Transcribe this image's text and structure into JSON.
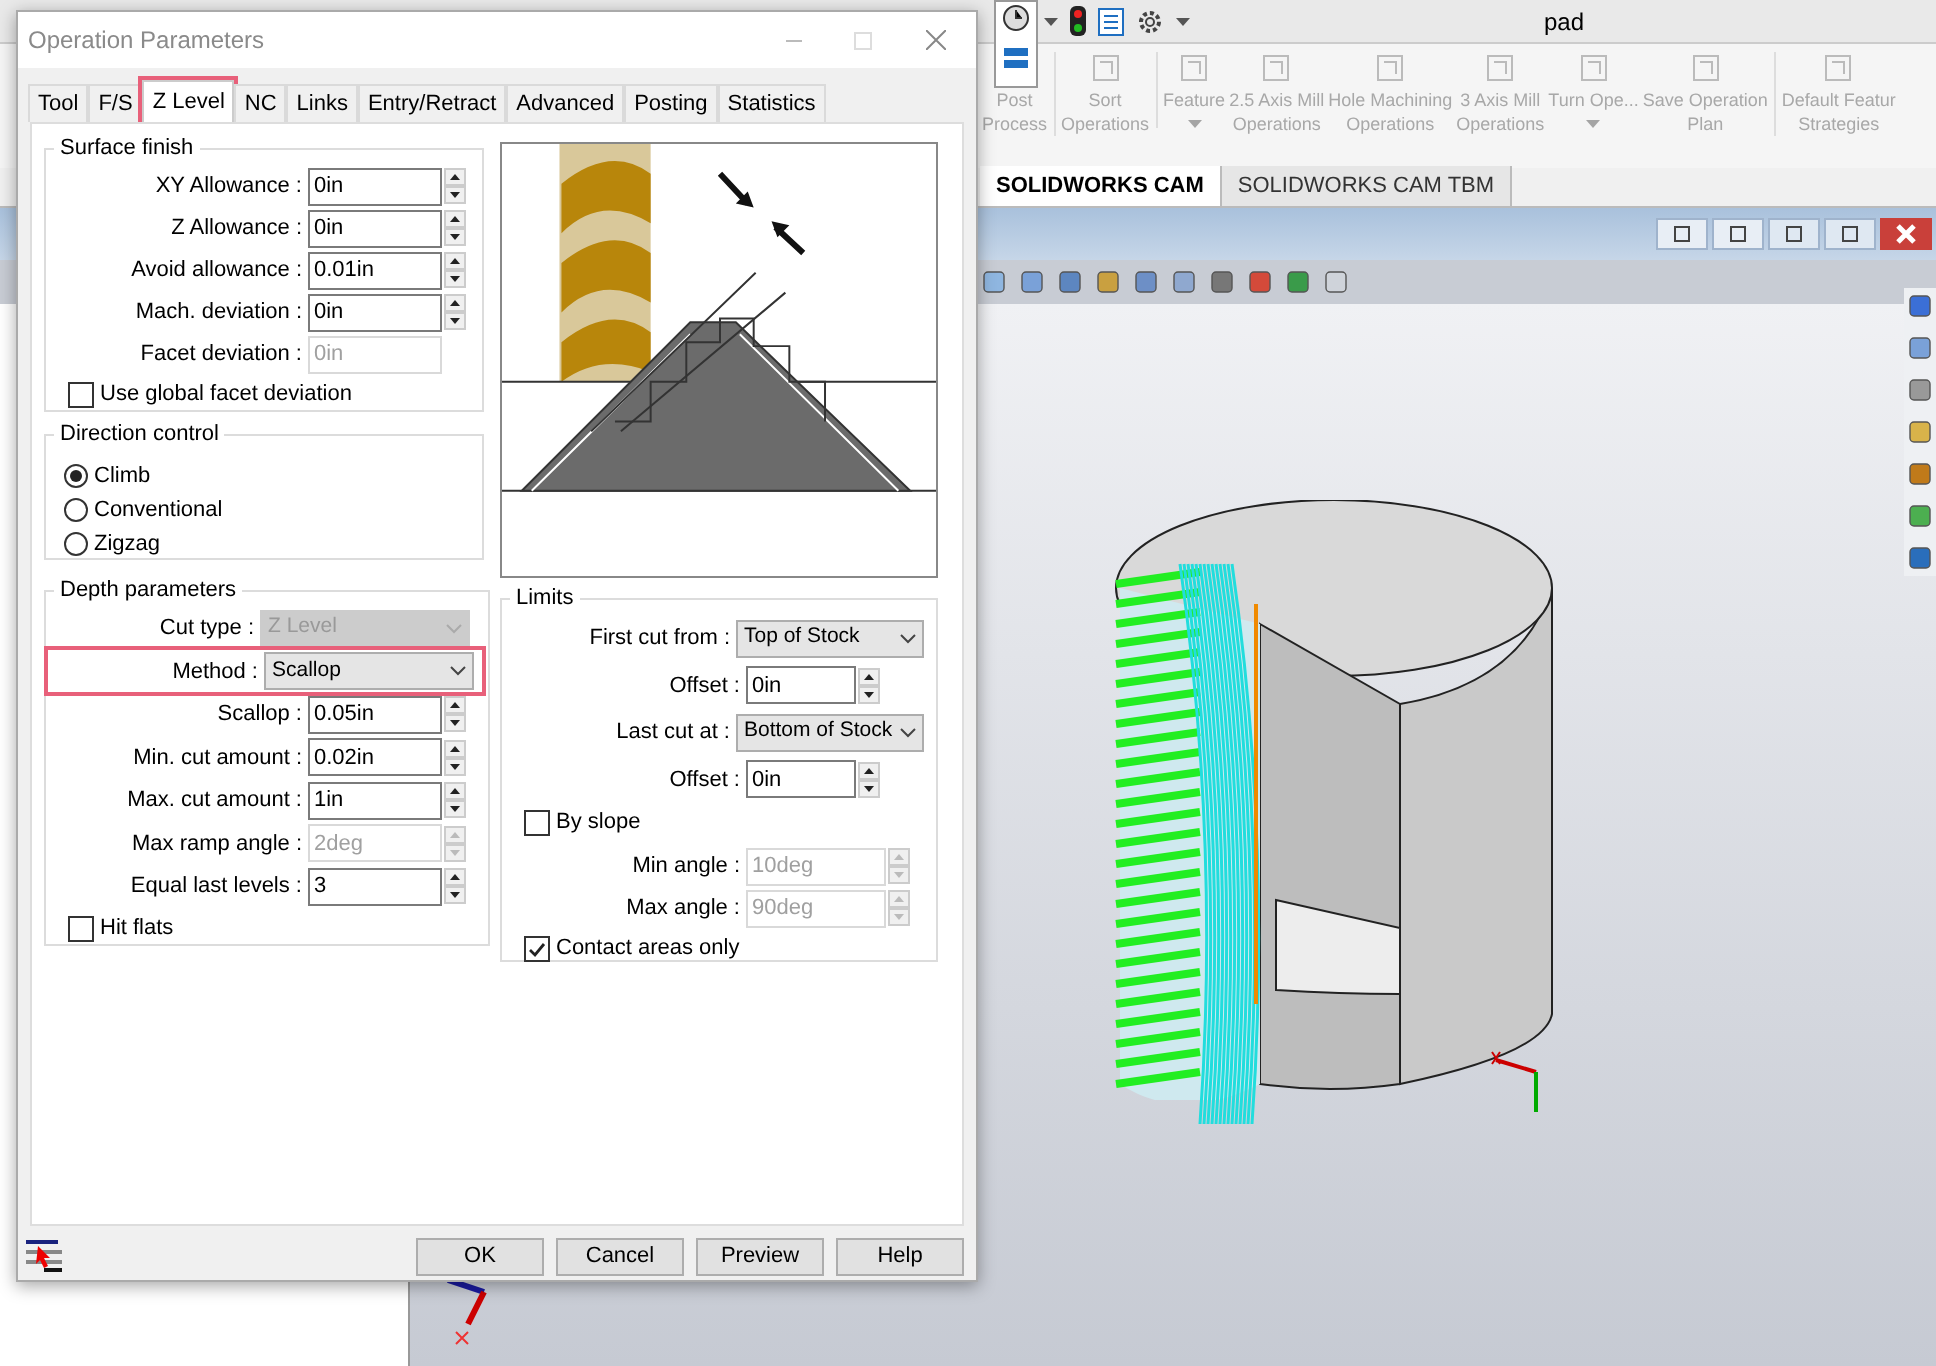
{
  "app": {
    "title": "pad",
    "ribbon": [
      {
        "label": "Post\nProcess",
        "dropdown": false
      },
      {
        "label": "Sort\nOperations",
        "dropdown": false
      },
      {
        "label": "Feature",
        "dropdown": true
      },
      {
        "label": "2.5 Axis Mill\nOperations",
        "dropdown": false
      },
      {
        "label": "Hole Machining\nOperations",
        "dropdown": false
      },
      {
        "label": "3 Axis Mill\nOperations",
        "dropdown": false
      },
      {
        "label": "Turn Ope...",
        "dropdown": true
      },
      {
        "label": "Save Operation\nPlan",
        "dropdown": false
      },
      {
        "label": "Default Featur\nStrategies",
        "dropdown": false
      }
    ],
    "tabs": [
      {
        "label": "SOLIDWORKS CAM",
        "selected": true
      },
      {
        "label": "SOLIDWORKS CAM TBM",
        "selected": false
      }
    ]
  },
  "dialog": {
    "title": "Operation Parameters",
    "tabs": [
      {
        "label": "Tool",
        "selected": false,
        "highlighted": false
      },
      {
        "label": "F/S",
        "selected": false,
        "highlighted": false
      },
      {
        "label": "Z Level",
        "selected": true,
        "highlighted": true
      },
      {
        "label": "NC",
        "selected": false,
        "highlighted": false
      },
      {
        "label": "Links",
        "selected": false,
        "highlighted": false
      },
      {
        "label": "Entry/Retract",
        "selected": false,
        "highlighted": false
      },
      {
        "label": "Advanced",
        "selected": false,
        "highlighted": false
      },
      {
        "label": "Posting",
        "selected": false,
        "highlighted": false
      },
      {
        "label": "Statistics",
        "selected": false,
        "highlighted": false
      }
    ],
    "surface_finish": {
      "title": "Surface finish",
      "fields": [
        {
          "kind": "spin",
          "label": "XY Allowance :",
          "value": "0in",
          "disabled": false
        },
        {
          "kind": "spin",
          "label": "Z Allowance :",
          "value": "0in",
          "disabled": false
        },
        {
          "kind": "spin",
          "label": "Avoid allowance :",
          "value": "0.01in",
          "disabled": false
        },
        {
          "kind": "spin",
          "label": "Mach. deviation :",
          "value": "0in",
          "disabled": false
        },
        {
          "kind": "text",
          "label": "Facet deviation :",
          "value": "0in",
          "disabled": true
        },
        {
          "kind": "check",
          "label": "Use global facet deviation",
          "checked": false
        }
      ]
    },
    "direction": {
      "title": "Direction control",
      "options": [
        {
          "label": "Climb",
          "selected": true
        },
        {
          "label": "Conventional",
          "selected": false
        },
        {
          "label": "Zigzag",
          "selected": false
        }
      ]
    },
    "depth": {
      "title": "Depth parameters",
      "fields": [
        {
          "kind": "select",
          "label": "Cut type :",
          "value": "Z Level",
          "disabled": true,
          "highlighted": false
        },
        {
          "kind": "select",
          "label": "Method :",
          "value": "Scallop",
          "disabled": false,
          "highlighted": true
        },
        {
          "kind": "spin",
          "label": "Scallop :",
          "value": "0.05in",
          "disabled": false
        },
        {
          "kind": "spin",
          "label": "Min. cut amount :",
          "value": "0.02in",
          "disabled": false
        },
        {
          "kind": "spin",
          "label": "Max. cut amount :",
          "value": "1in",
          "disabled": false
        },
        {
          "kind": "spin",
          "label": "Max ramp angle :",
          "value": "2deg",
          "disabled": true
        },
        {
          "kind": "spin",
          "label": "Equal last levels :",
          "value": "3",
          "disabled": false
        },
        {
          "kind": "check",
          "label": "Hit flats",
          "checked": false
        }
      ]
    },
    "limits": {
      "title": "Limits",
      "fields": [
        {
          "kind": "select",
          "label": "First cut from :",
          "value": "Top of Stock",
          "disabled": false
        },
        {
          "kind": "spin",
          "label": "Offset :",
          "value": "0in",
          "disabled": false
        },
        {
          "kind": "select",
          "label": "Last cut at :",
          "value": "Bottom of Stock",
          "disabled": false
        },
        {
          "kind": "spin",
          "label": "Offset :",
          "value": "0in",
          "disabled": false
        },
        {
          "kind": "check",
          "label": "By slope",
          "checked": false
        },
        {
          "kind": "spin",
          "label": "Min angle :",
          "value": "10deg",
          "disabled": true
        },
        {
          "kind": "spin",
          "label": "Max angle :",
          "value": "90deg",
          "disabled": true
        },
        {
          "kind": "check",
          "label": "Contact areas only",
          "checked": true
        }
      ]
    },
    "buttons": [
      "OK",
      "Cancel",
      "Preview",
      "Help"
    ]
  }
}
